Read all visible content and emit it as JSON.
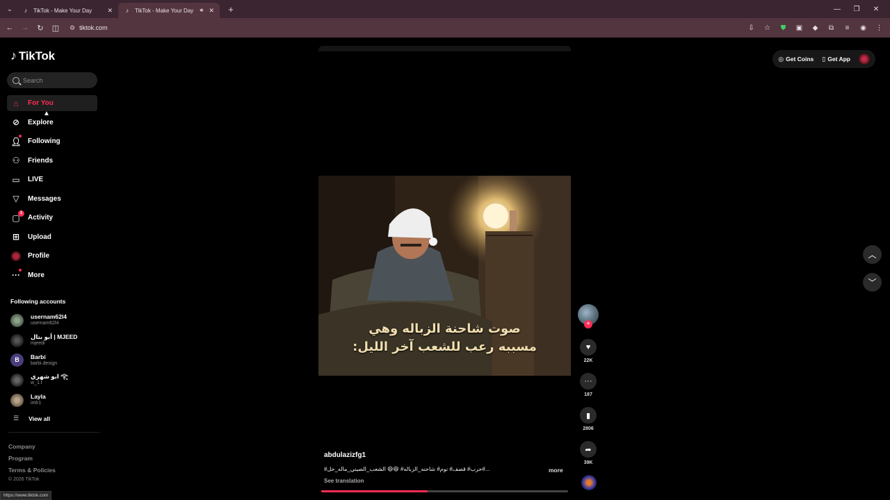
{
  "browser": {
    "tabs": [
      {
        "title": "TikTok - Make Your Day",
        "active": false
      },
      {
        "title": "TikTok - Make Your Day",
        "active": true
      }
    ],
    "url": "tiktok.com",
    "status_url": "https://www.tiktok.com"
  },
  "sidebar": {
    "logo": "TikTok",
    "search_placeholder": "Search",
    "nav": [
      {
        "label": "For You",
        "icon": "home-icon"
      },
      {
        "label": "Explore",
        "icon": "compass-icon"
      },
      {
        "label": "Following",
        "icon": "user-follow-icon"
      },
      {
        "label": "Friends",
        "icon": "friends-icon"
      },
      {
        "label": "LIVE",
        "icon": "live-icon"
      },
      {
        "label": "Messages",
        "icon": "messages-icon"
      },
      {
        "label": "Activity",
        "icon": "activity-icon",
        "badge": "1"
      },
      {
        "label": "Upload",
        "icon": "upload-icon"
      },
      {
        "label": "Profile",
        "icon": "avatar"
      },
      {
        "label": "More",
        "icon": "more-icon"
      }
    ],
    "following_title": "Following accounts",
    "following": [
      {
        "name": "usernam62l4",
        "handle": "usernam62l4",
        "color": "#6b7f6a"
      },
      {
        "name": "أبو بتال | MJEED",
        "handle": "mjeedi",
        "color": "#222222"
      },
      {
        "name": "Barbi",
        "handle": "barbi.design",
        "color": "#5b3fa0"
      },
      {
        "name": "ابو شهري 𓂀",
        "handle": "w_1.f",
        "color": "#333333"
      },
      {
        "name": "Layla",
        "handle": "imlr1",
        "color": "#8a7a66"
      }
    ],
    "view_all": "View all",
    "footer": [
      "Company",
      "Program",
      "Terms & Policies"
    ],
    "copyright": "© 2026 TikTok"
  },
  "topbar": {
    "get_coins": "Get Coins",
    "get_app": "Get App"
  },
  "video": {
    "caption_line1": "صوت شاحنة الزباله وهي",
    "caption_line2": "مسببه رعب للشعب آخر الليل:",
    "author": "abdulazizfg1",
    "description": "#حرب# قصف# نوم# شاحنه_الزباله# 😆😆 الشعب_الصيني_ماله_حل#...",
    "more": "more",
    "see_translation": "See translation",
    "progress": 0.43,
    "likes": "22K",
    "comments": "187",
    "saves": "2806",
    "shares": "39K"
  }
}
